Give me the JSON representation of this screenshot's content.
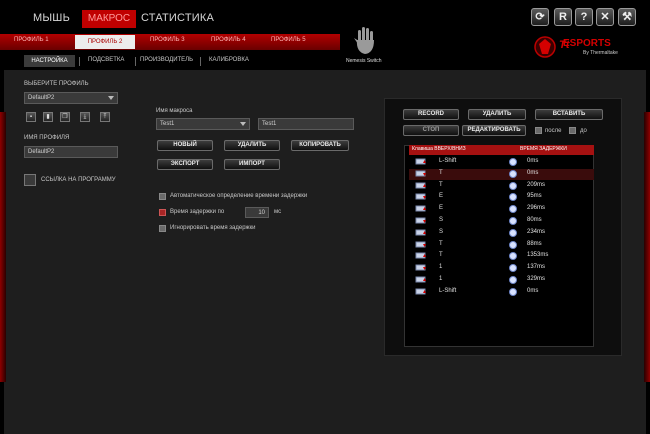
{
  "topbar": {
    "nav": {
      "mouse": "МЫШЬ",
      "macro": "МАКРОС",
      "stats": "СТАТИСТИКА"
    },
    "window_buttons": [
      {
        "name": "refresh-icon",
        "glyph": "⟳"
      },
      {
        "name": "reset-icon",
        "glyph": "R"
      },
      {
        "name": "help-icon",
        "glyph": "?"
      },
      {
        "name": "close-icon",
        "glyph": "✕"
      },
      {
        "name": "tools-icon",
        "glyph": "⚒"
      }
    ]
  },
  "profiles": [
    "ПРОФИЛЬ 1",
    "ПРОФИЛЬ 2",
    "ПРОФИЛЬ 3",
    "ПРОФИЛЬ 4",
    "ПРОФИЛЬ 5"
  ],
  "hand_label": "Nemesis Switch",
  "logo": {
    "text": "ESPORTS",
    "sub": "By Thermaltake"
  },
  "subtabs": [
    "НАСТРОЙКА",
    "ПОДСВЕТКА",
    "ПРОИЗВОДИТЕЛЬ",
    "КАЛИБРОВКА"
  ],
  "left": {
    "select_profile_label": "ВЫБЕРИТЕ ПРОФИЛЬ",
    "selected_profile": "DefaultP2",
    "profile_name_label": "ИМЯ ПРОФИЛЯ",
    "profile_name_value": "DefaultP2",
    "link_label": "ССЫЛКА НА ПРОГРАММУ"
  },
  "macro": {
    "name_label": "Имя макроса",
    "dropdown_value": "Test1",
    "name_value": "Test1",
    "buttons": {
      "new": "НОВЫЙ",
      "delete": "УДАЛИТЬ",
      "copy": "КОПИРОВАТЬ",
      "export": "ЭКСПОРТ",
      "import": "ИМПОРТ"
    },
    "options": {
      "auto_delay": "Автоматическое определение времени задержки",
      "delay_by": "Время задержки по",
      "delay_value": "10",
      "delay_unit": "мс",
      "ignore_delay": "Игнорировать время задержки"
    }
  },
  "recorder": {
    "record": "RECORD",
    "delete": "УДАЛИТЬ",
    "insert": "ВСТАВИТЬ",
    "stop": "СТОП",
    "edit": "РЕДАКТИРОВАТЬ",
    "after": "после",
    "before": "до",
    "col_keys": "Клавиша ВВЕРХ/ВНИЗ",
    "col_delay": "ВРЕМЯ ЗАДЕРЖКИ",
    "rows": [
      {
        "key": "L-Shift",
        "delay": "0ms",
        "dir": "up"
      },
      {
        "key": "T",
        "delay": "0ms",
        "dir": "down"
      },
      {
        "key": "T",
        "delay": "209ms",
        "dir": "up"
      },
      {
        "key": "E",
        "delay": "95ms",
        "dir": "down"
      },
      {
        "key": "E",
        "delay": "296ms",
        "dir": "up"
      },
      {
        "key": "S",
        "delay": "80ms",
        "dir": "down"
      },
      {
        "key": "S",
        "delay": "234ms",
        "dir": "up"
      },
      {
        "key": "T",
        "delay": "88ms",
        "dir": "down"
      },
      {
        "key": "T",
        "delay": "1353ms",
        "dir": "up"
      },
      {
        "key": "1",
        "delay": "137ms",
        "dir": "down"
      },
      {
        "key": "1",
        "delay": "329ms",
        "dir": "up"
      },
      {
        "key": "L-Shift",
        "delay": "0ms",
        "dir": "up"
      }
    ],
    "selected_row": 1
  },
  "colors": {
    "accent": "#c00000",
    "panel": "#1e1e1e",
    "header": "#a51111"
  }
}
